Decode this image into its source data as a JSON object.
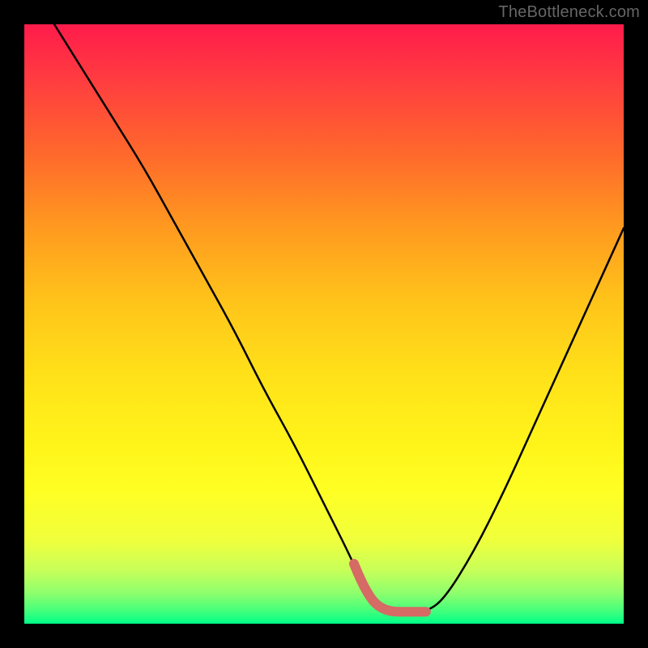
{
  "watermark": "TheBottleneck.com",
  "background_gradient": {
    "top": "#ff1b4b",
    "bottom": "#00ff88",
    "description": "red → orange → yellow → green vertical gradient"
  },
  "curve_style": {
    "main_color": "#000000",
    "main_width": 2.5,
    "highlight_color": "#d66a65",
    "highlight_width": 12
  },
  "chart_data": {
    "type": "line",
    "title": "",
    "xlabel": "",
    "ylabel": "",
    "xlim": [
      0,
      100
    ],
    "ylim": [
      0,
      100
    ],
    "series": [
      {
        "name": "bottleneck-curve",
        "x": [
          5,
          10,
          15,
          20,
          25,
          30,
          35,
          40,
          45,
          50,
          55,
          57,
          60,
          65,
          67,
          70,
          75,
          80,
          85,
          90,
          95,
          100
        ],
        "values": [
          100,
          92,
          84,
          76,
          67,
          58,
          49,
          39,
          30,
          20,
          10,
          5,
          2,
          2,
          2,
          4,
          12,
          22,
          33,
          44,
          55,
          66
        ]
      }
    ],
    "highlight_range_x": [
      55,
      67
    ],
    "minimum_x": 62
  }
}
